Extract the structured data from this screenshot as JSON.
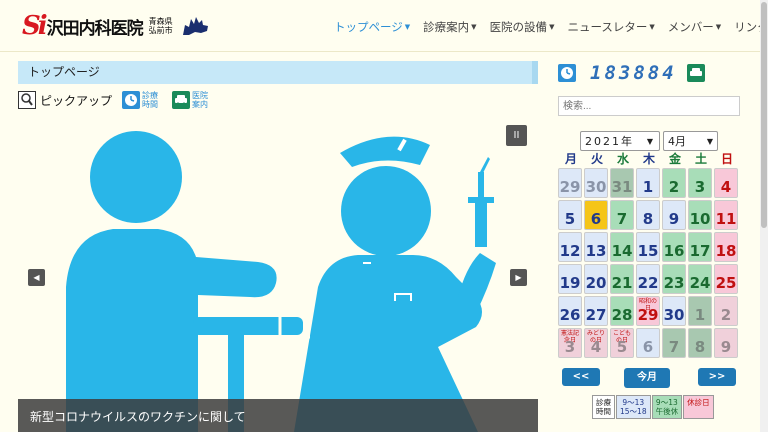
{
  "header": {
    "logo_mark": "Si",
    "logo_name": "沢田内科医院",
    "logo_pref": "青森県弘前市",
    "nav": [
      {
        "label": "トップページ",
        "active": true
      },
      {
        "label": "診療案内",
        "active": false
      },
      {
        "label": "医院の設備",
        "active": false
      },
      {
        "label": "ニュースレター",
        "active": false
      },
      {
        "label": "メンバー",
        "active": false
      },
      {
        "label": "リンク集",
        "active": false
      }
    ]
  },
  "page_title": "トップページ",
  "quick_links": {
    "pickup": "ピックアップ",
    "hours": "診療時間",
    "guide": "医院案内"
  },
  "slider": {
    "pause": "II",
    "prev": "◀",
    "next": "▶",
    "caption": "新型コロナウイルスのワクチンに関して"
  },
  "sidebar": {
    "counter": "183884",
    "search_placeholder": "検索...",
    "year_select": "2021年",
    "month_select": "4月",
    "weekdays": [
      "月",
      "火",
      "水",
      "木",
      "金",
      "土",
      "日"
    ],
    "weekday_colors": [
      "#223a8a",
      "#223a8a",
      "#1a7a3a",
      "#223a8a",
      "#1a7a3a",
      "#1a7a3a",
      "#c01010"
    ],
    "prev_label": "<<",
    "today_label": "今月",
    "next_label": ">>",
    "legend": [
      "診療\n時間",
      "9～13\n15～18",
      "9～13\n午後休",
      "休診日"
    ]
  },
  "calendar_cells": [
    {
      "day": "29",
      "type": "other"
    },
    {
      "day": "30",
      "type": "other"
    },
    {
      "day": "31",
      "type": "other-half"
    },
    {
      "day": "1",
      "type": "full"
    },
    {
      "day": "2",
      "type": "half"
    },
    {
      "day": "3",
      "type": "half"
    },
    {
      "day": "4",
      "type": "holiday"
    },
    {
      "day": "5",
      "type": "full"
    },
    {
      "day": "6",
      "type": "today"
    },
    {
      "day": "7",
      "type": "half"
    },
    {
      "day": "8",
      "type": "full"
    },
    {
      "day": "9",
      "type": "full"
    },
    {
      "day": "10",
      "type": "half"
    },
    {
      "day": "11",
      "type": "holiday"
    },
    {
      "day": "12",
      "type": "full"
    },
    {
      "day": "13",
      "type": "full"
    },
    {
      "day": "14",
      "type": "half"
    },
    {
      "day": "15",
      "type": "full"
    },
    {
      "day": "16",
      "type": "half"
    },
    {
      "day": "17",
      "type": "half"
    },
    {
      "day": "18",
      "type": "holiday"
    },
    {
      "day": "19",
      "type": "full"
    },
    {
      "day": "20",
      "type": "full"
    },
    {
      "day": "21",
      "type": "half"
    },
    {
      "day": "22",
      "type": "full"
    },
    {
      "day": "23",
      "type": "half"
    },
    {
      "day": "24",
      "type": "half"
    },
    {
      "day": "25",
      "type": "holiday"
    },
    {
      "day": "26",
      "type": "full"
    },
    {
      "day": "27",
      "type": "full"
    },
    {
      "day": "28",
      "type": "half"
    },
    {
      "day": "29",
      "type": "holiday",
      "note": "昭和の日"
    },
    {
      "day": "30",
      "type": "full"
    },
    {
      "day": "1",
      "type": "other-half"
    },
    {
      "day": "2",
      "type": "other-holiday"
    },
    {
      "day": "3",
      "type": "other-holiday",
      "note": "憲法記念日"
    },
    {
      "day": "4",
      "type": "other-holiday",
      "note": "みどりの日"
    },
    {
      "day": "5",
      "type": "other-holiday",
      "note": "こどもの日"
    },
    {
      "day": "6",
      "type": "other"
    },
    {
      "day": "7",
      "type": "other-half"
    },
    {
      "day": "8",
      "type": "other-half"
    },
    {
      "day": "9",
      "type": "other-holiday"
    }
  ],
  "colors": {
    "accent": "#2d8fd5",
    "figure_blue": "#29b6e8",
    "full_bg": "#dde8f8",
    "half_bg": "#a8ddb8",
    "holiday_bg": "#f8c8d8",
    "today_bg": "#f5c518"
  }
}
